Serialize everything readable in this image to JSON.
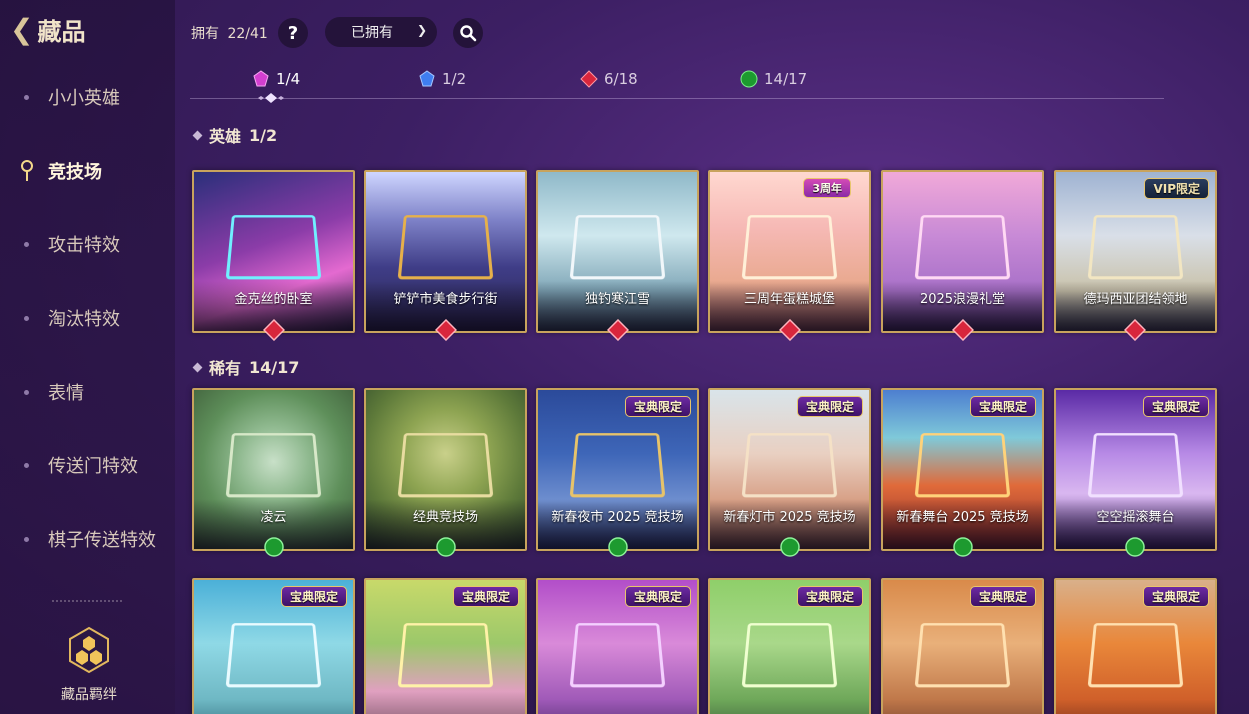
{
  "header": {
    "back_label": "藏品"
  },
  "sidebar": {
    "items": [
      {
        "label": "小小英雄",
        "active": false
      },
      {
        "label": "竞技场",
        "active": true
      },
      {
        "label": "攻击特效",
        "active": false
      },
      {
        "label": "淘汰特效",
        "active": false
      },
      {
        "label": "表情",
        "active": false
      },
      {
        "label": "传送门特效",
        "active": false
      },
      {
        "label": "棋子传送特效",
        "active": false
      }
    ],
    "bond_label": "藏品羁绊"
  },
  "toolbar": {
    "owned_label": "拥有",
    "owned_count": "22/41",
    "help_label": "?",
    "filter_value": "已拥有",
    "search_icon": "search-icon"
  },
  "rarity_tabs": [
    {
      "gem": "purple",
      "count": "1/4",
      "active": true
    },
    {
      "gem": "blue",
      "count": "1/2",
      "active": false
    },
    {
      "gem": "red",
      "count": "6/18",
      "active": false
    },
    {
      "gem": "green",
      "count": "14/17",
      "active": false
    }
  ],
  "sections": {
    "epic": {
      "title": "英雄",
      "count": "1/2"
    },
    "rare": {
      "title": "稀有",
      "count": "14/17"
    }
  },
  "cards": {
    "row1": [
      {
        "name": "金克丝的卧室",
        "gem": "red",
        "badge": ""
      },
      {
        "name": "铲铲市美食步行街",
        "gem": "red",
        "badge": ""
      },
      {
        "name": "独钓寒江雪",
        "gem": "red",
        "badge": ""
      },
      {
        "name": "三周年蛋糕城堡",
        "gem": "red",
        "badge": "3周年"
      },
      {
        "name": "2025浪漫礼堂",
        "gem": "red",
        "badge": ""
      },
      {
        "name": "德玛西亚团结领地",
        "gem": "red",
        "badge": "VIP限定"
      }
    ],
    "row2": [
      {
        "name": "凌云",
        "gem": "green",
        "badge": ""
      },
      {
        "name": "经典竞技场",
        "gem": "green",
        "badge": ""
      },
      {
        "name": "新春夜市 2025 竞技场",
        "gem": "green",
        "badge": "宝典限定"
      },
      {
        "name": "新春灯市 2025 竞技场",
        "gem": "green",
        "badge": "宝典限定"
      },
      {
        "name": "新春舞台 2025 竞技场",
        "gem": "green",
        "badge": "宝典限定"
      },
      {
        "name": "空空摇滚舞台",
        "gem": "green",
        "badge": "宝典限定"
      }
    ],
    "row3": [
      {
        "name": "",
        "badge": "宝典限定"
      },
      {
        "name": "",
        "badge": "宝典限定"
      },
      {
        "name": "",
        "badge": "宝典限定"
      },
      {
        "name": "",
        "badge": "宝典限定"
      },
      {
        "name": "",
        "badge": "宝典限定"
      },
      {
        "name": "",
        "badge": "宝典限定"
      }
    ]
  }
}
